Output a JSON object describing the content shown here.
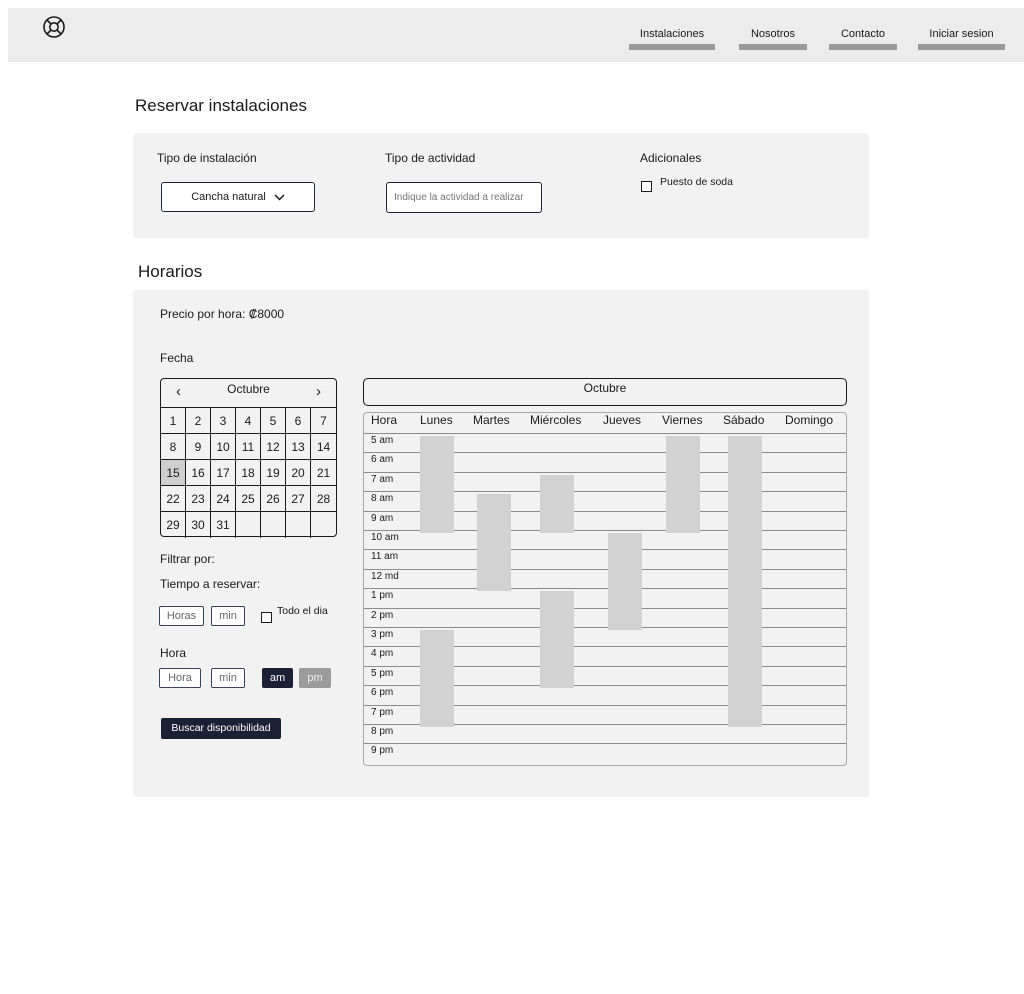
{
  "topbar": {
    "logo_icon": "lifebuoy-icon",
    "nav": [
      "Instalaciones",
      "Nosotros",
      "Contacto",
      "Iniciar sesion"
    ]
  },
  "reserve": {
    "title": "Reservar instalaciones",
    "tipo_instalacion_label": "Tipo de instalación",
    "tipo_instalacion_value": "Cancha natural",
    "tipo_actividad_label": "Tipo de actividad",
    "tipo_actividad_placeholder": "Indique la actividad a realizar",
    "adicionales_label": "Adicionales",
    "puesto_soda_label": "Puesto de soda"
  },
  "horarios": {
    "title": "Horarios",
    "precio": "Precio por hora: ₡8000",
    "fecha_label": "Fecha",
    "calendar": {
      "month": "Octubre",
      "days": [
        "1",
        "2",
        "3",
        "4",
        "5",
        "6",
        "7",
        "8",
        "9",
        "10",
        "11",
        "12",
        "13",
        "14",
        "15",
        "16",
        "17",
        "18",
        "19",
        "20",
        "21",
        "22",
        "23",
        "24",
        "25",
        "26",
        "27",
        "28",
        "29",
        "30",
        "31",
        "",
        "",
        "",
        ""
      ],
      "selected_day": "15"
    },
    "filtrar_label": "Filtrar por:",
    "tiempo_label": "Tiempo a reservar:",
    "horas_placeholder": "Horas",
    "min_placeholder": "min",
    "todo_dia_label": "Todo el dia",
    "hora_label": "Hora",
    "hora_placeholder": "Hora",
    "hora_min_placeholder": "min",
    "am_label": "am",
    "pm_label": "pm",
    "buscar_label": "Buscar disponibilidad",
    "week": {
      "month": "Octubre",
      "hour_col_label": "Hora",
      "days": [
        "Lunes",
        "Martes",
        "Miércoles",
        "Jueves",
        "Viernes",
        "Sábado",
        "Domingo"
      ],
      "hours": [
        "5 am",
        "6 am",
        "7 am",
        "8 am",
        "9 am",
        "10 am",
        "11 am",
        "12 md",
        "1 pm",
        "2 pm",
        "3 pm",
        "4 pm",
        "5 pm",
        "6 pm",
        "7 pm",
        "8 pm",
        "9 pm"
      ],
      "booked_blocks": [
        {
          "day": "Lunes",
          "start": "5 am",
          "end": "10 am"
        },
        {
          "day": "Lunes",
          "start": "3 pm",
          "end": "8 pm"
        },
        {
          "day": "Martes",
          "start": "8 am",
          "end": "1 pm"
        },
        {
          "day": "Miércoles",
          "start": "7 am",
          "end": "10 am"
        },
        {
          "day": "Miércoles",
          "start": "1 pm",
          "end": "6 pm"
        },
        {
          "day": "Jueves",
          "start": "10 am",
          "end": "3 pm"
        },
        {
          "day": "Viernes",
          "start": "5 am",
          "end": "10 am"
        },
        {
          "day": "Sábado",
          "start": "5 am",
          "end": "8 pm"
        }
      ]
    }
  }
}
